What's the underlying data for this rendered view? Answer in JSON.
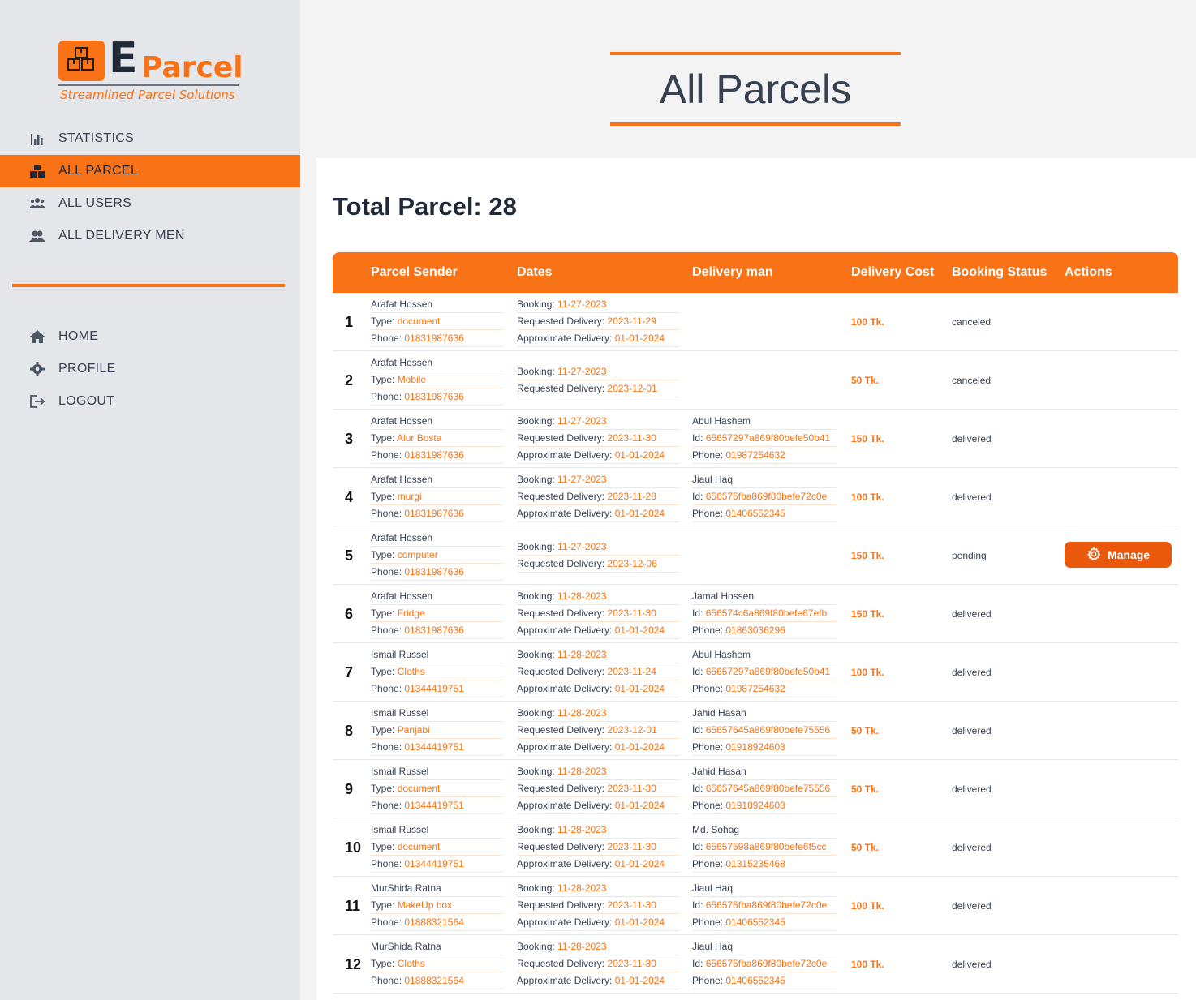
{
  "sidebar": {
    "logo": {
      "letter": "E",
      "word": "Parcel",
      "tagline": "Streamlined Parcel Solutions"
    },
    "nav_top": [
      {
        "label": "STATISTICS",
        "icon": "chart-bar-icon",
        "active": false
      },
      {
        "label": "ALL PARCEL",
        "icon": "boxes-icon",
        "active": true
      },
      {
        "label": "ALL USERS",
        "icon": "users-icon",
        "active": false
      },
      {
        "label": "ALL DELIVERY MEN",
        "icon": "user-group-icon",
        "active": false
      }
    ],
    "nav_bottom": [
      {
        "label": "HOME",
        "icon": "home-icon"
      },
      {
        "label": "PROFILE",
        "icon": "gear-icon"
      },
      {
        "label": "LOGOUT",
        "icon": "logout-icon"
      }
    ]
  },
  "main": {
    "title": "All Parcels",
    "total_label": "Total Parcel: 28",
    "columns": [
      "Parcel Sender",
      "Dates",
      "Delivery man",
      "Delivery Cost",
      "Booking Status",
      "Actions"
    ],
    "labels": {
      "type": "Type: ",
      "phone": "Phone: ",
      "booking": "Booking: ",
      "requested": "Requested Delivery: ",
      "approximate": "Approximate Delivery: ",
      "id": "Id: "
    },
    "manage_label": "Manage",
    "rows": [
      {
        "num": "1",
        "sender": "Arafat Hossen",
        "type": "document",
        "phone": "01831987636",
        "booking": "11-27-2023",
        "requested": "2023-11-29",
        "approximate": "01-01-2024",
        "dm_name": "",
        "dm_id": "",
        "dm_phone": "",
        "cost": "100 Tk.",
        "status": "canceled",
        "manage": false
      },
      {
        "num": "2",
        "sender": "Arafat Hossen",
        "type": "Mobile",
        "phone": "01831987636",
        "booking": "11-27-2023",
        "requested": "2023-12-01",
        "approximate": "",
        "dm_name": "",
        "dm_id": "",
        "dm_phone": "",
        "cost": "50 Tk.",
        "status": "canceled",
        "manage": false
      },
      {
        "num": "3",
        "sender": "Arafat Hossen",
        "type": "Alur Bosta",
        "phone": "01831987636",
        "booking": "11-27-2023",
        "requested": "2023-11-30",
        "approximate": "01-01-2024",
        "dm_name": "Abul Hashem",
        "dm_id": "65657297a869f80befe50b41",
        "dm_phone": "01987254632",
        "cost": "150 Tk.",
        "status": "delivered",
        "manage": false
      },
      {
        "num": "4",
        "sender": "Arafat Hossen",
        "type": "murgi",
        "phone": "01831987636",
        "booking": "11-27-2023",
        "requested": "2023-11-28",
        "approximate": "01-01-2024",
        "dm_name": "Jiaul Haq",
        "dm_id": "656575fba869f80befe72c0e",
        "dm_phone": "01406552345",
        "cost": "100 Tk.",
        "status": "delivered",
        "manage": false
      },
      {
        "num": "5",
        "sender": "Arafat Hossen",
        "type": "computer",
        "phone": "01831987636",
        "booking": "11-27-2023",
        "requested": "2023-12-06",
        "approximate": "",
        "dm_name": "",
        "dm_id": "",
        "dm_phone": "",
        "cost": "150 Tk.",
        "status": "pending",
        "manage": true
      },
      {
        "num": "6",
        "sender": "Arafat Hossen",
        "type": "Fridge",
        "phone": "01831987636",
        "booking": "11-28-2023",
        "requested": "2023-11-30",
        "approximate": "01-01-2024",
        "dm_name": "Jamal Hossen",
        "dm_id": "656574c6a869f80befe67efb",
        "dm_phone": "01863036296",
        "cost": "150 Tk.",
        "status": "delivered",
        "manage": false
      },
      {
        "num": "7",
        "sender": "Ismail Russel",
        "type": "Cloths",
        "phone": "01344419751",
        "booking": "11-28-2023",
        "requested": "2023-11-24",
        "approximate": "01-01-2024",
        "dm_name": "Abul Hashem",
        "dm_id": "65657297a869f80befe50b41",
        "dm_phone": "01987254632",
        "cost": "100 Tk.",
        "status": "delivered",
        "manage": false
      },
      {
        "num": "8",
        "sender": "Ismail Russel",
        "type": "Panjabi",
        "phone": "01344419751",
        "booking": "11-28-2023",
        "requested": "2023-12-01",
        "approximate": "01-01-2024",
        "dm_name": "Jahid Hasan",
        "dm_id": "65657645a869f80befe75556",
        "dm_phone": "01918924603",
        "cost": "50 Tk.",
        "status": "delivered",
        "manage": false
      },
      {
        "num": "9",
        "sender": "Ismail Russel",
        "type": "document",
        "phone": "01344419751",
        "booking": "11-28-2023",
        "requested": "2023-11-30",
        "approximate": "01-01-2024",
        "dm_name": "Jahid Hasan",
        "dm_id": "65657645a869f80befe75556",
        "dm_phone": "01918924603",
        "cost": "50 Tk.",
        "status": "delivered",
        "manage": false
      },
      {
        "num": "10",
        "sender": "Ismail Russel",
        "type": "document",
        "phone": "01344419751",
        "booking": "11-28-2023",
        "requested": "2023-11-30",
        "approximate": "01-01-2024",
        "dm_name": "Md. Sohag",
        "dm_id": "65657598a869f80befe6f5cc",
        "dm_phone": "01315235468",
        "cost": "50 Tk.",
        "status": "delivered",
        "manage": false
      },
      {
        "num": "11",
        "sender": "MurShida Ratna",
        "type": "MakeUp box",
        "phone": "01888321564",
        "booking": "11-28-2023",
        "requested": "2023-11-30",
        "approximate": "01-01-2024",
        "dm_name": "Jiaul Haq",
        "dm_id": "656575fba869f80befe72c0e",
        "dm_phone": "01406552345",
        "cost": "100 Tk.",
        "status": "delivered",
        "manage": false
      },
      {
        "num": "12",
        "sender": "MurShida Ratna",
        "type": "Cloths",
        "phone": "01888321564",
        "booking": "11-28-2023",
        "requested": "2023-11-30",
        "approximate": "01-01-2024",
        "dm_name": "Jiaul Haq",
        "dm_id": "656575fba869f80befe72c0e",
        "dm_phone": "01406552345",
        "cost": "100 Tk.",
        "status": "delivered",
        "manage": false
      }
    ]
  },
  "colors": {
    "accent": "#f97316",
    "sidebar_bg": "#e5e6e9",
    "button": "#ea580c"
  }
}
